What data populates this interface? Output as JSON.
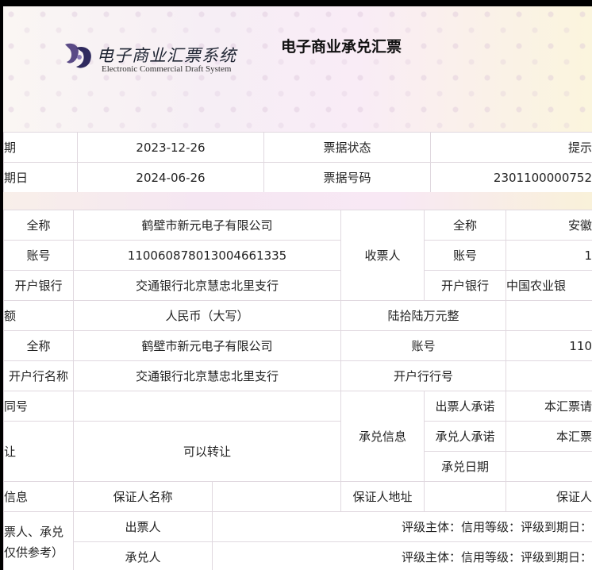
{
  "header": {
    "logo_cn": "电子商业汇票系统",
    "logo_en": "Electronic Commercial Draft System",
    "title": "电子商业承兑汇票"
  },
  "info": {
    "issue_label": "期",
    "issue_date": "2023-12-26",
    "status_label": "票据状态",
    "status_value": "提示",
    "due_label": "期日",
    "due_date": "2024-06-26",
    "no_label": "票据号码",
    "no_value": "2301100000752"
  },
  "drawer": {
    "name_label": "全称",
    "name": "鹤壁市新元电子有限公司",
    "account_label": "账号",
    "account": "110060878013004661335",
    "bank_label": "开户银行",
    "bank": "交通银行北京慧忠北里支行"
  },
  "payee": {
    "section_label": "收票人",
    "name_label": "全称",
    "name": "安徽",
    "account_label": "账号",
    "account": "1",
    "bank_label": "开户银行",
    "bank": "中国农业银"
  },
  "amount": {
    "label": "额",
    "currency_label": "人民币（大写）",
    "value": "陆拾陆万元整"
  },
  "acceptor": {
    "name_label": "全称",
    "name": "鹤壁市新元电子有限公司",
    "account_label": "账号",
    "account": "110",
    "bank_label": "开户行名称",
    "bank": "交通银行北京慧忠北里支行",
    "bank_no_label": "开户行行号"
  },
  "contract": {
    "label": "同号"
  },
  "transfer": {
    "label": "让",
    "value": "可以转让"
  },
  "acceptance": {
    "section_label": "承兑信息",
    "drawer_promise_label": "出票人承诺",
    "drawer_promise": "本汇票请",
    "acceptor_promise_label": "承兑人承诺",
    "acceptor_promise": "本汇票",
    "date_label": "承兑日期"
  },
  "guarantee": {
    "label": "信息",
    "name_label": "保证人名称",
    "address_label": "保证人地址",
    "guarantor_label": "保证人"
  },
  "rating": {
    "label_line1": "票人、承兑",
    "label_line2": "仅供参考）",
    "drawer_label": "出票人",
    "drawer_value": "评级主体：信用等级：评级到期日：",
    "acceptor_label": "承兑人",
    "acceptor_value": "评级主体：信用等级：评级到期日："
  }
}
